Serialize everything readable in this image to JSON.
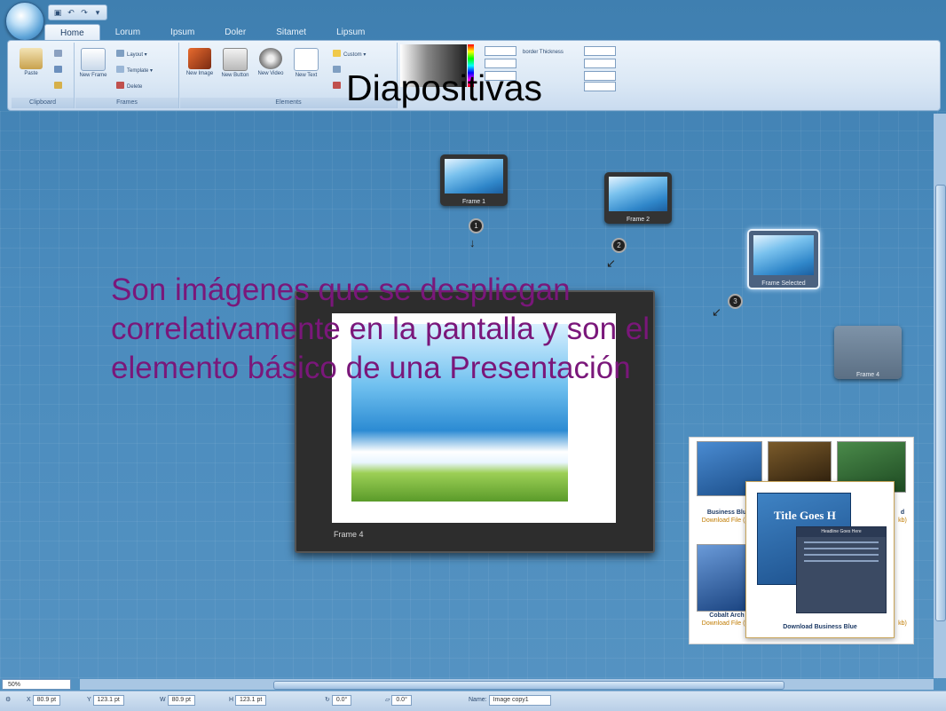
{
  "slide": {
    "title": "Diapositivas",
    "body": "Son imágenes que se despliegan correlativamente en la pantalla y son el elemento básico de una Presentación"
  },
  "ribbon": {
    "tabs": [
      "Home",
      "Lorum",
      "Ipsum",
      "Doler",
      "Sitamet",
      "Lipsum"
    ],
    "groups": {
      "clipboard": {
        "caption": "Clipboard",
        "paste": "Paste"
      },
      "frames": {
        "caption": "Frames",
        "new_frame": "New Frame",
        "layout": "Layout",
        "template": "Template",
        "delete": "Delete"
      },
      "elements": {
        "caption": "Elements",
        "new_image": "New Image",
        "new_button": "New Button",
        "new_video": "New Video",
        "new_text": "New Text",
        "custom": "Custom"
      }
    },
    "border_thickness_label": "border Thickness"
  },
  "canvas": {
    "frames": [
      "Frame 1",
      "Frame 2",
      "Frame Selected",
      "Frame 4"
    ],
    "big_frame_label": "Frame 4"
  },
  "templates": {
    "items": [
      {
        "name": "Business Blu",
        "download": "Download File (19"
      },
      {
        "name": "Cobalt Arch",
        "download": "Download File (59"
      }
    ],
    "right_suffix_1": "d",
    "right_suffix_2": "kb)",
    "right_suffix_3": "kb)",
    "front_title": "Title Goes H",
    "front_headline": "Headline Goes Here",
    "front_caption": "Download Business Blue"
  },
  "status": {
    "zoom": "50%",
    "x_label": "X",
    "x_value": "80.9 pt",
    "y_label": "Y",
    "y_value": "123.1 pt",
    "w_label": "W",
    "w_value": "80.9 pt",
    "h_label": "H",
    "h_value": "123.1 pt",
    "rotate_value": "0.0°",
    "skew_value": "0.0°",
    "name_label": "Name:",
    "name_value": "Image copy1"
  },
  "colors": {
    "title": "#000000",
    "body": "#7a177a",
    "accent": "#4a8bbd"
  }
}
